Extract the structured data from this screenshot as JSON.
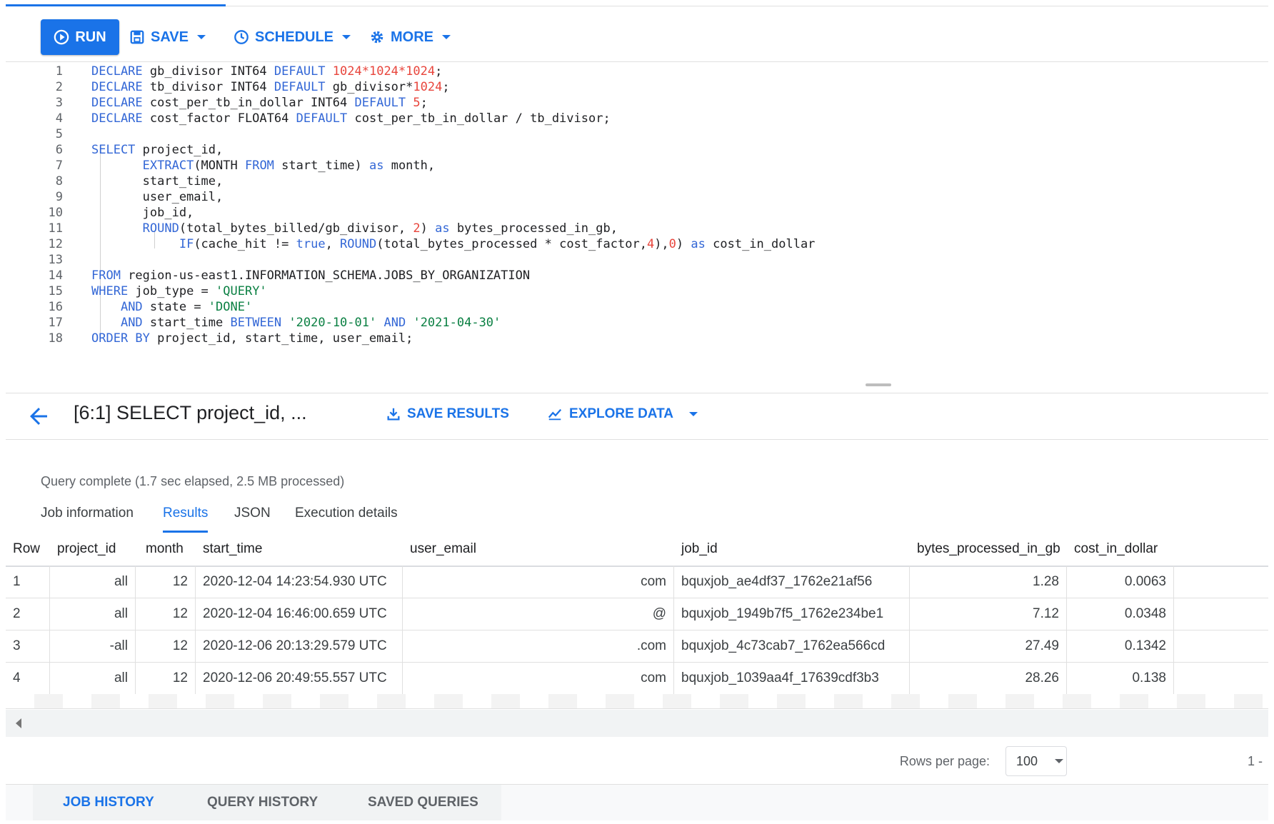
{
  "toolbar": {
    "run_label": "RUN",
    "save_label": "SAVE",
    "schedule_label": "SCHEDULE",
    "more_label": "MORE"
  },
  "editor": {
    "line_numbers": [
      "1",
      "2",
      "3",
      "4",
      "5",
      "6",
      "7",
      "8",
      "9",
      "10",
      "11",
      "12",
      "13",
      "14",
      "15",
      "16",
      "17",
      "18"
    ]
  },
  "results_header": {
    "title": "[6:1] SELECT project_id, ...",
    "save_results_label": "SAVE RESULTS",
    "explore_data_label": "EXPLORE DATA"
  },
  "status": "Query complete (1.7 sec elapsed, 2.5 MB processed)",
  "tabs": [
    "Job information",
    "Results",
    "JSON",
    "Execution details"
  ],
  "active_tab": "Results",
  "table": {
    "columns": [
      "Row",
      "project_id",
      "month",
      "start_time",
      "user_email",
      "job_id",
      "bytes_processed_in_gb",
      "cost_in_dollar"
    ],
    "rows": [
      {
        "row": "1",
        "project_id": "all",
        "month": "12",
        "start_time": "2020-12-04 14:23:54.930 UTC",
        "user_email": "com",
        "job_id": "bquxjob_ae4df37_1762e21af56",
        "bytes": "1.28",
        "cost": "0.0063"
      },
      {
        "row": "2",
        "project_id": "all",
        "month": "12",
        "start_time": "2020-12-04 16:46:00.659 UTC",
        "user_email": "@",
        "job_id": "bquxjob_1949b7f5_1762e234be1",
        "bytes": "7.12",
        "cost": "0.0348"
      },
      {
        "row": "3",
        "project_id": "-all",
        "month": "12",
        "start_time": "2020-12-06 20:13:29.579 UTC",
        "user_email": ".com",
        "job_id": "bquxjob_4c73cab7_1762ea566cd",
        "bytes": "27.49",
        "cost": "0.1342"
      },
      {
        "row": "4",
        "project_id": "all",
        "month": "12",
        "start_time": "2020-12-06 20:49:55.557 UTC",
        "user_email": "com",
        "job_id": "bquxjob_1039aa4f_17639cdf3b3",
        "bytes": "28.26",
        "cost": "0.138"
      }
    ]
  },
  "pager": {
    "rows_per_page_label": "Rows per page:",
    "rows_per_page_value": "100",
    "range_text": "1 -"
  },
  "bottom_tabs": [
    "JOB HISTORY",
    "QUERY HISTORY",
    "SAVED QUERIES"
  ],
  "colors": {
    "accent": "#1a73e8",
    "keyword": "#3367d6",
    "number": "#e8453c",
    "string": "#0b8043"
  }
}
